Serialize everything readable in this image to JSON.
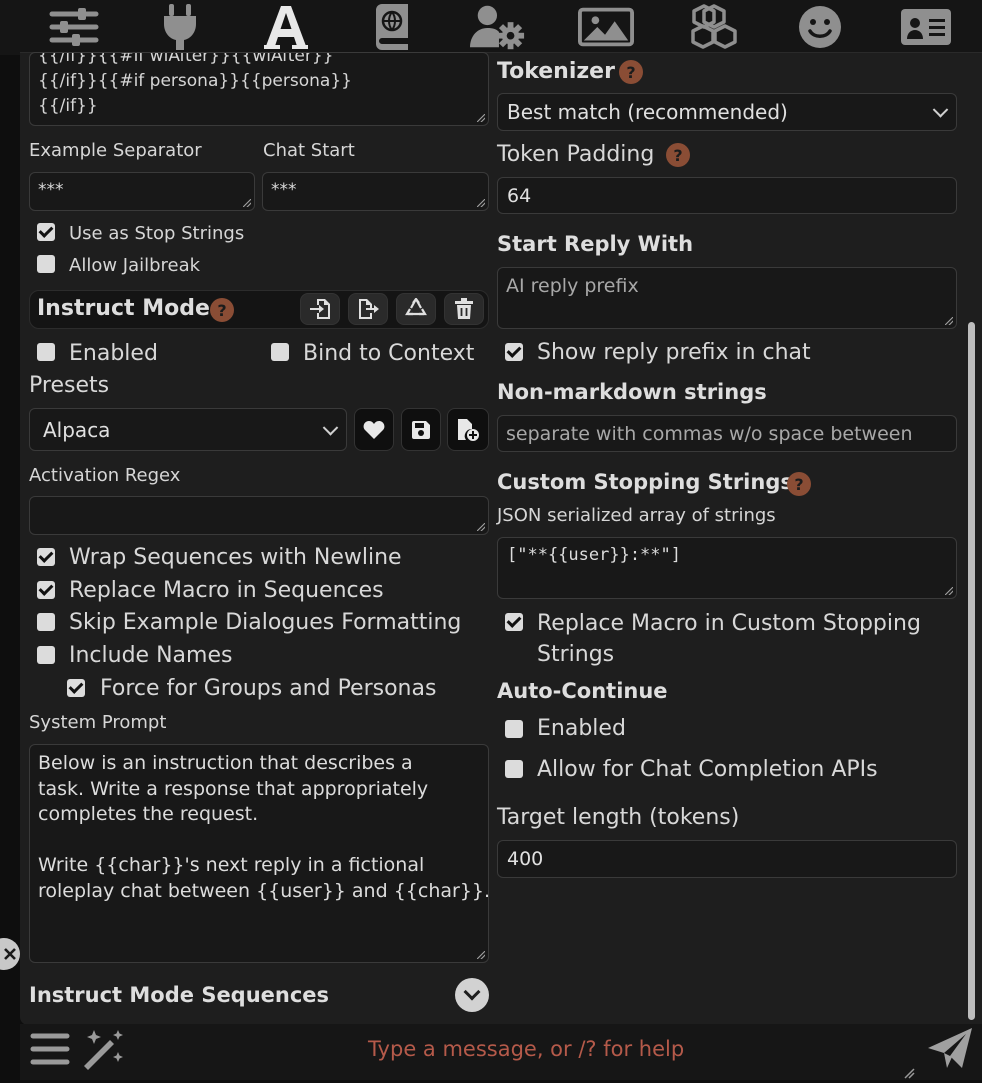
{
  "topbar": {
    "icons": [
      "sliders-icon",
      "plug-icon",
      "font-icon",
      "book-globe-icon",
      "user-gear-icon",
      "image-icon",
      "cubes-icon",
      "smiley-icon",
      "id-card-icon"
    ]
  },
  "left": {
    "story_string_tail": "{{/if}}{{#if wiAfter}}{{wiAfter}}\n{{/if}}{{#if persona}}{{persona}}\n{{/if}}",
    "example_separator": {
      "label": "Example Separator",
      "value": "***"
    },
    "chat_start": {
      "label": "Chat Start",
      "value": "***"
    },
    "use_stop_strings": {
      "label": "Use as Stop Strings",
      "checked": true
    },
    "allow_jailbreak": {
      "label": "Allow Jailbreak",
      "checked": false
    },
    "instruct": {
      "title": "Instruct Mode",
      "help": "?",
      "enabled": {
        "label": "Enabled",
        "checked": false
      },
      "bind": {
        "label": "Bind to Context",
        "checked": false
      },
      "presets_label": "Presets",
      "preset_value": "Alpaca",
      "activation_regex_label": "Activation Regex",
      "activation_regex_value": "",
      "wrap": {
        "label": "Wrap Sequences with Newline",
        "checked": true
      },
      "replace_macro": {
        "label": "Replace Macro in Sequences",
        "checked": true
      },
      "skip_examples": {
        "label": "Skip Example Dialogues Formatting",
        "checked": false
      },
      "include_names": {
        "label": "Include Names",
        "checked": false
      },
      "force_groups": {
        "label": "Force for Groups and Personas",
        "checked": true
      },
      "system_prompt_label": "System Prompt",
      "system_prompt": "Below is an instruction that describes a\ntask. Write a response that appropriately\ncompletes the request.\n\nWrite {{char}}'s next reply in a fictional\nroleplay chat between {{user}} and {{char}}.",
      "sequences_label": "Instruct Mode Sequences"
    }
  },
  "right": {
    "tokenizer": {
      "label": "Tokenizer",
      "help": "?",
      "value": "Best match (recommended)"
    },
    "token_padding": {
      "label": "Token Padding",
      "help": "?",
      "value": "64"
    },
    "start_reply": {
      "label": "Start Reply With",
      "placeholder": "AI reply prefix"
    },
    "show_prefix": {
      "label": "Show reply prefix in chat",
      "checked": true
    },
    "non_markdown": {
      "label": "Non-markdown strings",
      "placeholder": "separate with commas w/o space between"
    },
    "custom_stop": {
      "label": "Custom Stopping Strings",
      "help": "?",
      "sub": "JSON serialized array of strings",
      "value": "[\"**{{user}}:**\"]"
    },
    "replace_macro_custom": {
      "label": "Replace Macro in Custom Stopping Strings",
      "checked": true
    },
    "auto_continue": {
      "label": "Auto-Continue",
      "enabled": {
        "label": "Enabled",
        "checked": false
      },
      "allow_chat": {
        "label": "Allow for Chat Completion APIs",
        "checked": false
      },
      "target_label": "Target length (tokens)",
      "target_value": "400"
    }
  },
  "bottom": {
    "placeholder": "Type a message, or /? for help"
  },
  "colors": {
    "panel": "#1e1e1e",
    "accent_help": "#8a4d35",
    "placeholder_text": "#b55a4a"
  }
}
